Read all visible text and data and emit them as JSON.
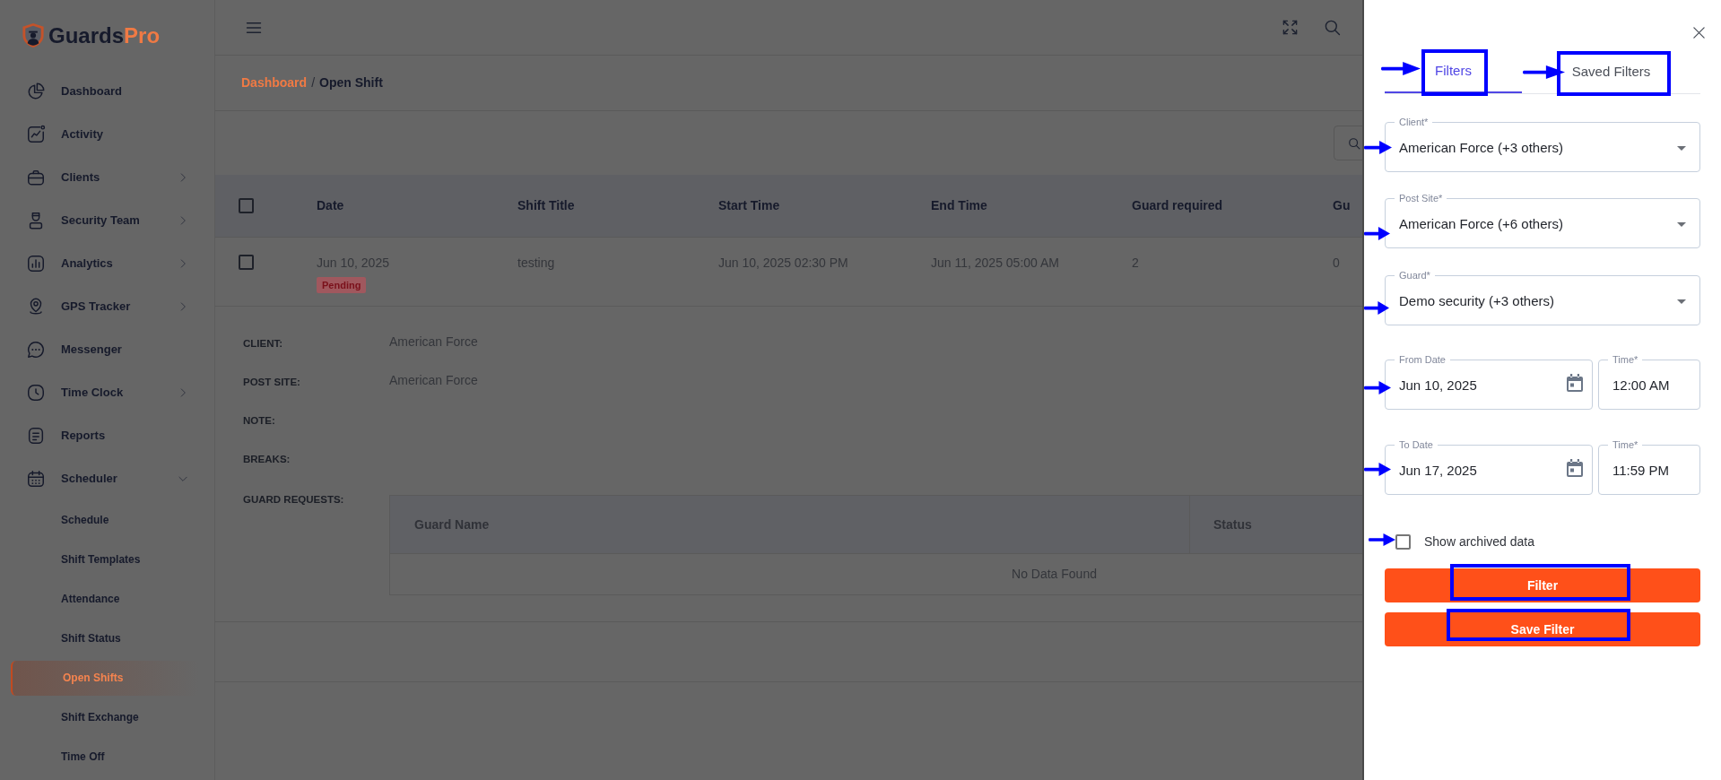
{
  "sidebar": {
    "logo": {
      "name": "Guards",
      "accent": "Pro"
    },
    "items": [
      {
        "label": "Dashboard",
        "kind": "link",
        "selected": false
      },
      {
        "label": "Activity",
        "kind": "link",
        "selected": false
      },
      {
        "label": "Clients",
        "kind": "group",
        "expanded": false,
        "selected": false
      },
      {
        "label": "Security Team",
        "kind": "group",
        "expanded": false,
        "selected": false
      },
      {
        "label": "Analytics",
        "kind": "group",
        "expanded": false,
        "selected": false
      },
      {
        "label": "GPS Tracker",
        "kind": "group",
        "expanded": false,
        "selected": false
      },
      {
        "label": "Messenger",
        "kind": "link",
        "selected": false
      },
      {
        "label": "Time Clock",
        "kind": "group",
        "expanded": false,
        "selected": false
      },
      {
        "label": "Reports",
        "kind": "link",
        "selected": false
      },
      {
        "label": "Scheduler",
        "kind": "group",
        "expanded": true,
        "selected": false,
        "children": [
          {
            "label": "Schedule",
            "selected": false
          },
          {
            "label": "Shift Templates",
            "selected": false
          },
          {
            "label": "Attendance",
            "selected": false
          },
          {
            "label": "Shift Status",
            "selected": false
          },
          {
            "label": "Open Shifts",
            "selected": true
          },
          {
            "label": "Shift Exchange",
            "selected": false
          },
          {
            "label": "Time Off",
            "selected": false
          }
        ]
      }
    ]
  },
  "breadcrumb": {
    "items": [
      {
        "label": "Dashboard",
        "kind": "link"
      },
      {
        "label": "Open Shift",
        "kind": "current"
      }
    ],
    "separator": "/"
  },
  "table": {
    "select_all": {
      "checked": false
    },
    "columns": [
      "Date",
      "Shift Title",
      "Start Time",
      "End Time",
      "Guard required",
      "Gu"
    ],
    "rows": [
      {
        "checked": false,
        "cells": [
          "Jun 10, 2025",
          "testing",
          "Jun 10, 2025 02:30 PM",
          "Jun 11, 2025 05:00 AM",
          "2",
          "0"
        ],
        "status": "Pending"
      }
    ]
  },
  "details": {
    "fields": [
      {
        "label": "CLIENT:",
        "value": "American Force"
      },
      {
        "label": "POST SITE:",
        "value": "American Force"
      },
      {
        "label": "NOTE:"
      },
      {
        "label": "BREAKS:"
      }
    ],
    "guard_requests": {
      "label": "GUARD REQUESTS:",
      "columns": [
        "Guard Name",
        "Status"
      ],
      "empty_text": "No Data Found"
    }
  },
  "filter_panel": {
    "tabs": [
      {
        "label": "Filters",
        "selected": true
      },
      {
        "label": "Saved Filters",
        "selected": false
      }
    ],
    "selects": [
      {
        "label": "Client*",
        "value": "American Force (+3 others)"
      },
      {
        "label": "Post Site*",
        "value": "American Force (+6 others)"
      },
      {
        "label": "Guard*",
        "value": "Demo security (+3 others)"
      }
    ],
    "date_ranges": [
      {
        "date_label": "From Date",
        "date": "Jun 10, 2025",
        "time_label": "Time*",
        "time": "12:00 AM"
      },
      {
        "date_label": "To Date",
        "date": "Jun 17, 2025",
        "time_label": "Time*",
        "time": "11:59 PM"
      }
    ],
    "archived": {
      "label": "Show archived data",
      "checked": false
    },
    "buttons": [
      "Filter",
      "Save Filter"
    ]
  }
}
